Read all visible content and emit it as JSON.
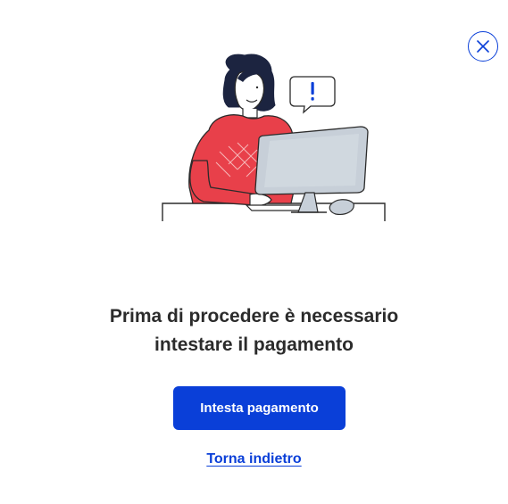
{
  "dialog": {
    "close_icon": "close-circle-icon",
    "illustration_icon": "person-at-computer-alert-illustration",
    "headline_line1": "Prima di procedere è necessario",
    "headline_line2": "intestare il pagamento",
    "primary_button_label": "Intesta pagamento",
    "back_link_label": "Torna indietro",
    "colors": {
      "accent": "#0a3fd8",
      "text": "#2b2b2b",
      "sweater": "#e8404a",
      "monitor": "#c7cfd8"
    }
  }
}
